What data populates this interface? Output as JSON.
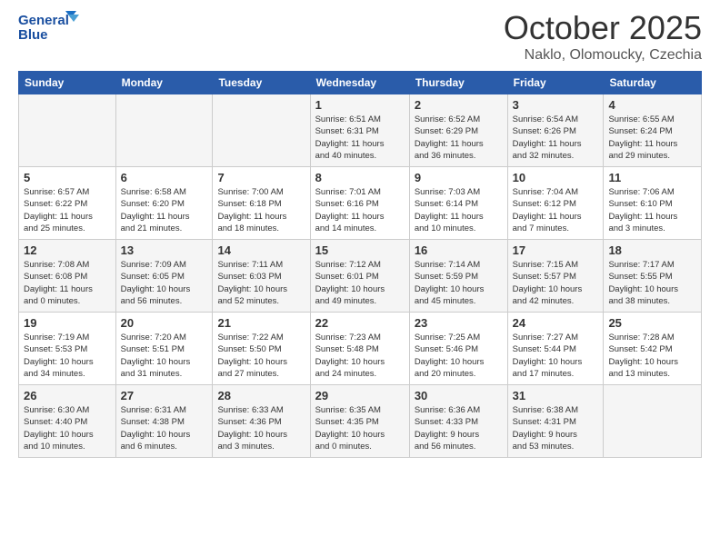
{
  "header": {
    "logo_line1": "General",
    "logo_line2": "Blue",
    "month": "October 2025",
    "location": "Naklo, Olomoucky, Czechia"
  },
  "weekdays": [
    "Sunday",
    "Monday",
    "Tuesday",
    "Wednesday",
    "Thursday",
    "Friday",
    "Saturday"
  ],
  "weeks": [
    [
      {
        "day": "",
        "info": ""
      },
      {
        "day": "",
        "info": ""
      },
      {
        "day": "",
        "info": ""
      },
      {
        "day": "1",
        "info": "Sunrise: 6:51 AM\nSunset: 6:31 PM\nDaylight: 11 hours\nand 40 minutes."
      },
      {
        "day": "2",
        "info": "Sunrise: 6:52 AM\nSunset: 6:29 PM\nDaylight: 11 hours\nand 36 minutes."
      },
      {
        "day": "3",
        "info": "Sunrise: 6:54 AM\nSunset: 6:26 PM\nDaylight: 11 hours\nand 32 minutes."
      },
      {
        "day": "4",
        "info": "Sunrise: 6:55 AM\nSunset: 6:24 PM\nDaylight: 11 hours\nand 29 minutes."
      }
    ],
    [
      {
        "day": "5",
        "info": "Sunrise: 6:57 AM\nSunset: 6:22 PM\nDaylight: 11 hours\nand 25 minutes."
      },
      {
        "day": "6",
        "info": "Sunrise: 6:58 AM\nSunset: 6:20 PM\nDaylight: 11 hours\nand 21 minutes."
      },
      {
        "day": "7",
        "info": "Sunrise: 7:00 AM\nSunset: 6:18 PM\nDaylight: 11 hours\nand 18 minutes."
      },
      {
        "day": "8",
        "info": "Sunrise: 7:01 AM\nSunset: 6:16 PM\nDaylight: 11 hours\nand 14 minutes."
      },
      {
        "day": "9",
        "info": "Sunrise: 7:03 AM\nSunset: 6:14 PM\nDaylight: 11 hours\nand 10 minutes."
      },
      {
        "day": "10",
        "info": "Sunrise: 7:04 AM\nSunset: 6:12 PM\nDaylight: 11 hours\nand 7 minutes."
      },
      {
        "day": "11",
        "info": "Sunrise: 7:06 AM\nSunset: 6:10 PM\nDaylight: 11 hours\nand 3 minutes."
      }
    ],
    [
      {
        "day": "12",
        "info": "Sunrise: 7:08 AM\nSunset: 6:08 PM\nDaylight: 11 hours\nand 0 minutes."
      },
      {
        "day": "13",
        "info": "Sunrise: 7:09 AM\nSunset: 6:05 PM\nDaylight: 10 hours\nand 56 minutes."
      },
      {
        "day": "14",
        "info": "Sunrise: 7:11 AM\nSunset: 6:03 PM\nDaylight: 10 hours\nand 52 minutes."
      },
      {
        "day": "15",
        "info": "Sunrise: 7:12 AM\nSunset: 6:01 PM\nDaylight: 10 hours\nand 49 minutes."
      },
      {
        "day": "16",
        "info": "Sunrise: 7:14 AM\nSunset: 5:59 PM\nDaylight: 10 hours\nand 45 minutes."
      },
      {
        "day": "17",
        "info": "Sunrise: 7:15 AM\nSunset: 5:57 PM\nDaylight: 10 hours\nand 42 minutes."
      },
      {
        "day": "18",
        "info": "Sunrise: 7:17 AM\nSunset: 5:55 PM\nDaylight: 10 hours\nand 38 minutes."
      }
    ],
    [
      {
        "day": "19",
        "info": "Sunrise: 7:19 AM\nSunset: 5:53 PM\nDaylight: 10 hours\nand 34 minutes."
      },
      {
        "day": "20",
        "info": "Sunrise: 7:20 AM\nSunset: 5:51 PM\nDaylight: 10 hours\nand 31 minutes."
      },
      {
        "day": "21",
        "info": "Sunrise: 7:22 AM\nSunset: 5:50 PM\nDaylight: 10 hours\nand 27 minutes."
      },
      {
        "day": "22",
        "info": "Sunrise: 7:23 AM\nSunset: 5:48 PM\nDaylight: 10 hours\nand 24 minutes."
      },
      {
        "day": "23",
        "info": "Sunrise: 7:25 AM\nSunset: 5:46 PM\nDaylight: 10 hours\nand 20 minutes."
      },
      {
        "day": "24",
        "info": "Sunrise: 7:27 AM\nSunset: 5:44 PM\nDaylight: 10 hours\nand 17 minutes."
      },
      {
        "day": "25",
        "info": "Sunrise: 7:28 AM\nSunset: 5:42 PM\nDaylight: 10 hours\nand 13 minutes."
      }
    ],
    [
      {
        "day": "26",
        "info": "Sunrise: 6:30 AM\nSunset: 4:40 PM\nDaylight: 10 hours\nand 10 minutes."
      },
      {
        "day": "27",
        "info": "Sunrise: 6:31 AM\nSunset: 4:38 PM\nDaylight: 10 hours\nand 6 minutes."
      },
      {
        "day": "28",
        "info": "Sunrise: 6:33 AM\nSunset: 4:36 PM\nDaylight: 10 hours\nand 3 minutes."
      },
      {
        "day": "29",
        "info": "Sunrise: 6:35 AM\nSunset: 4:35 PM\nDaylight: 10 hours\nand 0 minutes."
      },
      {
        "day": "30",
        "info": "Sunrise: 6:36 AM\nSunset: 4:33 PM\nDaylight: 9 hours\nand 56 minutes."
      },
      {
        "day": "31",
        "info": "Sunrise: 6:38 AM\nSunset: 4:31 PM\nDaylight: 9 hours\nand 53 minutes."
      },
      {
        "day": "",
        "info": ""
      }
    ]
  ]
}
